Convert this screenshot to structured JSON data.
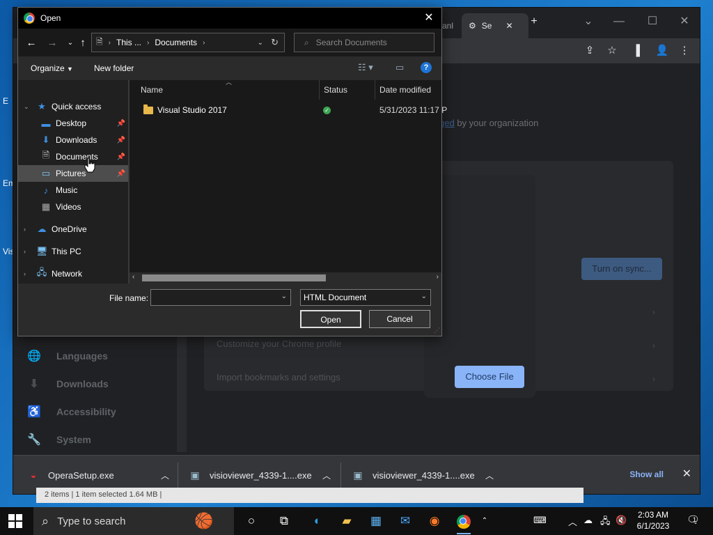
{
  "dialog": {
    "title": "Open",
    "address": {
      "segment1": "This ...",
      "segment2": "Documents"
    },
    "search_placeholder": "Search Documents",
    "commands": {
      "organize": "Organize",
      "new_folder": "New folder"
    },
    "nav_items": [
      {
        "label": "Quick access",
        "icon": "star-icon"
      },
      {
        "label": "Desktop",
        "icon": "desktop-folder-icon"
      },
      {
        "label": "Downloads",
        "icon": "download-arrow-icon"
      },
      {
        "label": "Documents",
        "icon": "document-icon"
      },
      {
        "label": "Pictures",
        "icon": "picture-icon"
      },
      {
        "label": "Music",
        "icon": "music-note-icon"
      },
      {
        "label": "Videos",
        "icon": "video-icon"
      },
      {
        "label": "OneDrive",
        "icon": "cloud-icon"
      },
      {
        "label": "This PC",
        "icon": "computer-icon"
      },
      {
        "label": "Network",
        "icon": "network-icon"
      }
    ],
    "columns": [
      "Name",
      "Status",
      "Date modified"
    ],
    "files": [
      {
        "name": "Visual Studio 2017",
        "status": "synced",
        "date": "5/31/2023 11:17 P"
      }
    ],
    "file_name_label": "File name:",
    "file_name_value": "",
    "file_type": "HTML Document",
    "open_label": "Open",
    "cancel_label": "Cancel"
  },
  "chrome": {
    "tab_partial": "anl",
    "settings_tab": "Se",
    "managed_link": "ged",
    "managed_text": "by your organization",
    "turn_on_sync": "Turn on sync...",
    "choose_file": "Choose File",
    "customize_row": "Customize your Chrome profile",
    "import_row": "Import bookmarks and settings",
    "sidebar": [
      "Languages",
      "Downloads",
      "Accessibility",
      "System"
    ]
  },
  "downloads": {
    "items": [
      {
        "name": "OperaSetup.exe",
        "icon": "opera-installer-icon"
      },
      {
        "name": "visioviewer_4339-1....exe",
        "icon": "exe-installer-icon"
      },
      {
        "name": "visioviewer_4339-1....exe",
        "icon": "exe-installer-icon"
      }
    ],
    "show_all": "Show all"
  },
  "explorer_status": "2 items  |  1 item selected  1.64 MB  |",
  "taskbar": {
    "search_placeholder": "Type to search",
    "time": "2:03 AM",
    "date": "6/1/2023",
    "notification_count": "1"
  },
  "colors": {
    "accent": "#8ab4f8",
    "dialog_bg": "#2b2b2b",
    "desktop": "#1a6fb5"
  }
}
